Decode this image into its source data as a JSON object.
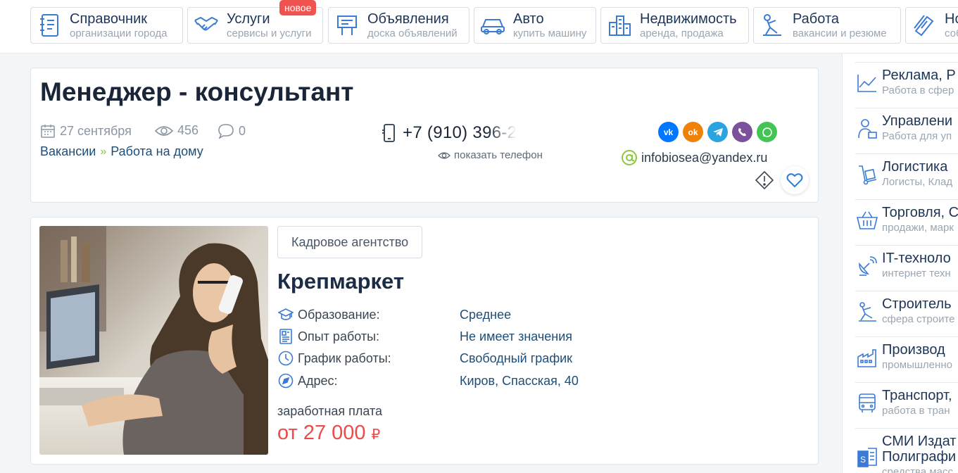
{
  "nav": {
    "items": [
      {
        "title": "Справочник",
        "subtitle": "организации города",
        "icon": "directory-icon"
      },
      {
        "title": "Услуги",
        "subtitle": "сервисы и услуги",
        "icon": "handshake-icon",
        "badge": "новое"
      },
      {
        "title": "Объявления",
        "subtitle": "доска объявлений",
        "icon": "billboard-icon"
      },
      {
        "title": "Авто",
        "subtitle": "купить машину",
        "icon": "car-icon"
      },
      {
        "title": "Недвижимость",
        "subtitle": "аренда, продажа",
        "icon": "buildings-icon"
      },
      {
        "title": "Работа",
        "subtitle": "вакансии и резюме",
        "icon": "worker-icon"
      },
      {
        "title": "Но",
        "subtitle": "соб",
        "icon": "news-icon"
      }
    ]
  },
  "job": {
    "title": "Менеджер - консультант",
    "date": "27 сентября",
    "views": "456",
    "comments": "0",
    "breadcrumb": [
      "Вакансии",
      "Работа на дому"
    ],
    "phone": "+7 (910) 396-2",
    "show_phone": "показать телефон",
    "email": "infobiosea@yandex.ru",
    "social": [
      {
        "name": "vk",
        "label": "vk",
        "color": "#0077ff"
      },
      {
        "name": "ok",
        "label": "ok",
        "color": "#ee8208"
      },
      {
        "name": "telegram",
        "label": "tg",
        "color": "#2aa3e0"
      },
      {
        "name": "viber",
        "label": "vb",
        "color": "#7b519d"
      },
      {
        "name": "whatsapp",
        "label": "wa",
        "color": "#43c553"
      }
    ]
  },
  "company": {
    "agency_label": "Кадровое агентство",
    "name": "Крепмаркет",
    "attributes": [
      {
        "label": "Образование:",
        "value": "Среднее",
        "icon": "graduation-cap-icon"
      },
      {
        "label": "Опыт работы:",
        "value": "Не имеет значения",
        "icon": "resume-icon"
      },
      {
        "label": "График работы:",
        "value": "Свободный график",
        "icon": "clock-icon"
      },
      {
        "label": "Адрес:",
        "value": "Киров, Спасская, 40",
        "icon": "compass-icon"
      }
    ],
    "salary_label": "заработная плата",
    "salary": "от 27 000",
    "currency": "₽"
  },
  "sidebar": {
    "items": [
      {
        "title": "Реклама, Р",
        "subtitle": "Работа в сфер",
        "icon": "chart-icon"
      },
      {
        "title": "Управлени",
        "subtitle": "Работа для уп",
        "icon": "manager-icon"
      },
      {
        "title": "Логистика",
        "subtitle": "Логисты, Клад",
        "icon": "hand-truck-icon"
      },
      {
        "title": "Торговля, С",
        "subtitle": "продажи, марк",
        "icon": "basket-icon"
      },
      {
        "title": "IT-техноло",
        "subtitle": "интернет техн",
        "icon": "satellite-icon"
      },
      {
        "title": "Строитель",
        "subtitle": "сфера строите",
        "icon": "crane-icon"
      },
      {
        "title": "Производ",
        "subtitle": "промышленно",
        "icon": "factory-icon"
      },
      {
        "title": "Транспорт,",
        "subtitle": "работа в тран",
        "icon": "bus-icon"
      },
      {
        "title": "СМИ Издат",
        "title2": "Полиграфи",
        "subtitle": "средства масс",
        "icon": "publisher-icon"
      }
    ]
  },
  "colors": {
    "accent": "#1d4e7a",
    "icon": "#3a7bd5",
    "salary": "#ee4a4a",
    "badge": "#f0524f",
    "breadcrumb_sep": "#8dc63f"
  }
}
